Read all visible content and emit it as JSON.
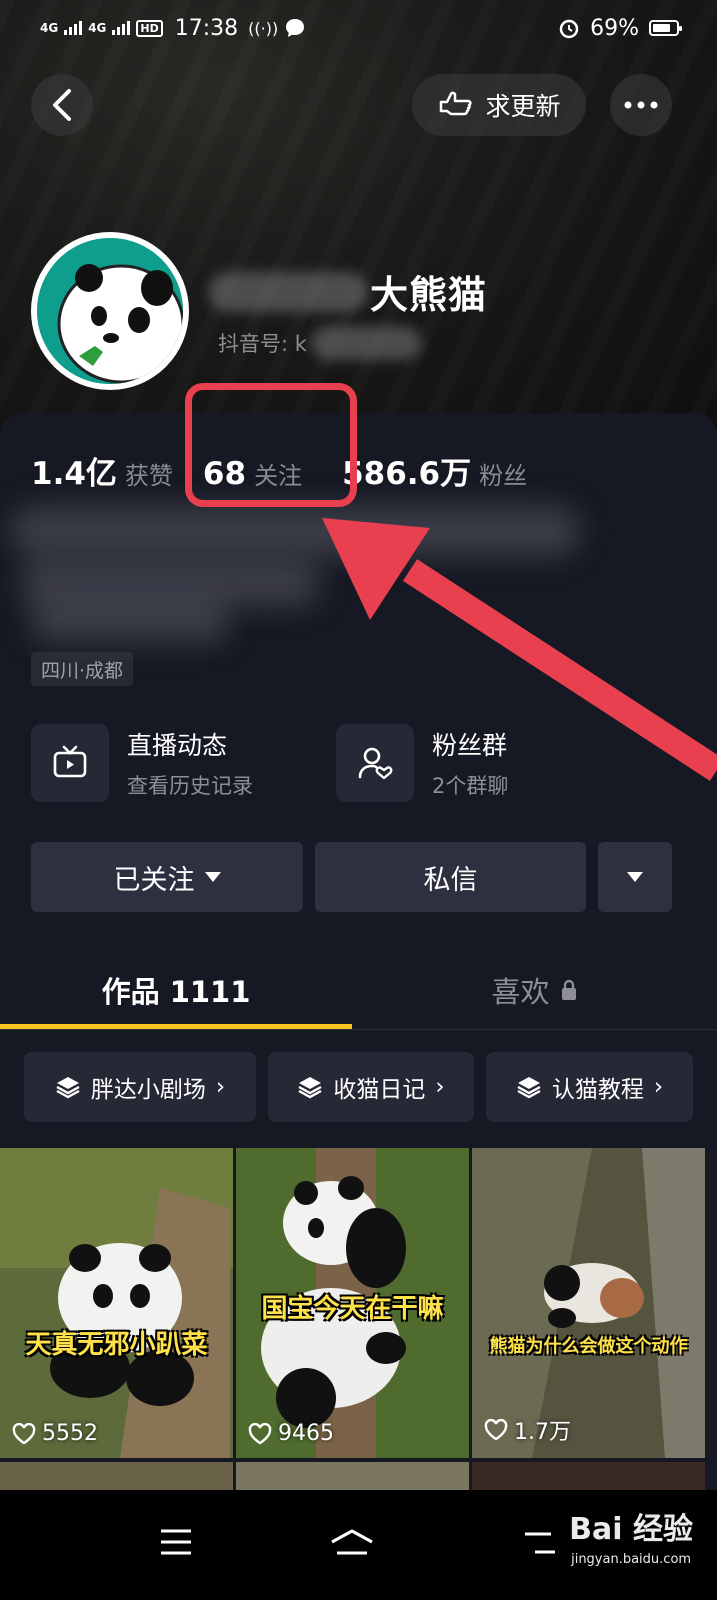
{
  "status_bar": {
    "network_1": "4G",
    "network_2": "4G",
    "hd": "HD",
    "time": "17:38",
    "battery": "69%"
  },
  "header": {
    "update_label": "求更新"
  },
  "profile": {
    "name_visible": "大熊猫",
    "douyin_id_label": "抖音号: k"
  },
  "stats": {
    "likes_value": "1.4亿",
    "likes_label": "获赞",
    "following_value": "68",
    "following_label": "关注",
    "followers_value": "586.6万",
    "followers_label": "粉丝"
  },
  "location": "四川·成都",
  "features": [
    {
      "title": "直播动态",
      "subtitle": "查看历史记录",
      "icon": "tv-icon"
    },
    {
      "title": "粉丝群",
      "subtitle": "2个群聊",
      "icon": "user-heart-icon"
    }
  ],
  "actions": {
    "followed_label": "已关注",
    "message_label": "私信"
  },
  "tabs": [
    {
      "label": "作品 1111",
      "active": true
    },
    {
      "label": "喜欢",
      "locked": true
    }
  ],
  "collections": [
    {
      "label": "胖达小剧场"
    },
    {
      "label": "收猫日记"
    },
    {
      "label": "认猫教程"
    }
  ],
  "videos": [
    {
      "caption": "天真无邪小趴菜",
      "likes": "5552"
    },
    {
      "caption": "国宝今天在干嘛",
      "likes": "9465"
    },
    {
      "caption": "熊猫为什么会做这个动作",
      "likes": "1.7万"
    }
  ],
  "watermark": {
    "brand": "Bai 经验",
    "url": "jingyan.baidu.com"
  },
  "colors": {
    "background": "#161823",
    "accent_underline": "#f6c320",
    "annotation_red": "#e8404e",
    "caption_yellow": "#ffe14a"
  }
}
